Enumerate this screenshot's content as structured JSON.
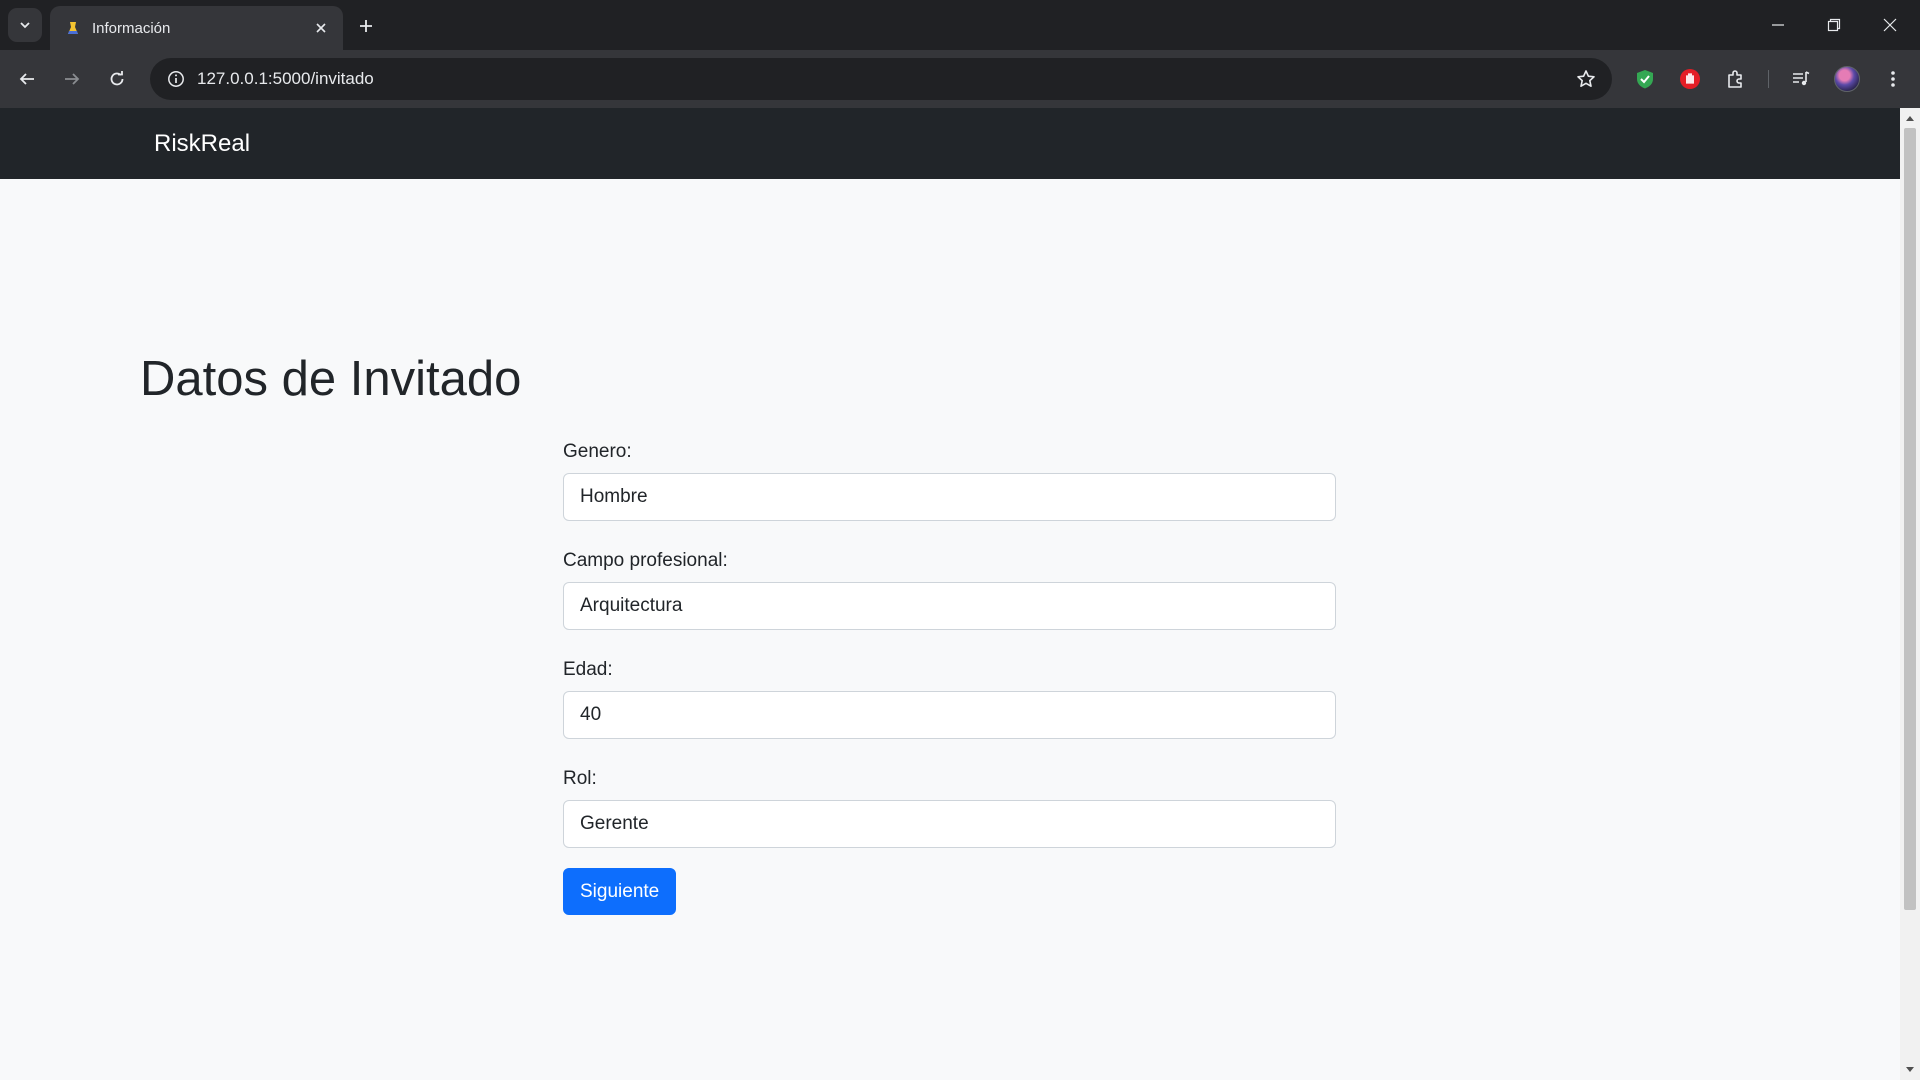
{
  "browser": {
    "tab_title": "Información",
    "url": "127.0.0.1:5000/invitado",
    "icons": {
      "tab_search": "chevron-down-icon",
      "favicon": "flask-favicon-icon",
      "close": "close-icon",
      "new_tab": "plus-icon",
      "back": "arrow-left-icon",
      "forward": "arrow-right-icon",
      "reload": "reload-icon",
      "site_info": "info-icon",
      "bookmark": "star-icon",
      "ext1": "shield-extension-icon",
      "ext2": "stop-hand-extension-icon",
      "extensions": "puzzle-icon",
      "media": "media-queue-icon",
      "menu": "kebab-menu-icon"
    },
    "colors": {
      "frame": "#202124",
      "toolbar": "#35363a",
      "text": "#e8eaed"
    }
  },
  "navbar": {
    "brand": "RiskReal"
  },
  "page": {
    "title": "Datos de Invitado",
    "form": {
      "fields": [
        {
          "label": "Genero:",
          "value": "Hombre"
        },
        {
          "label": "Campo profesional:",
          "value": "Arquitectura"
        },
        {
          "label": "Edad:",
          "value": "40"
        },
        {
          "label": "Rol:",
          "value": "Gerente"
        }
      ],
      "submit_label": "Siguiente"
    }
  },
  "colors": {
    "navbar": "#212529",
    "page_bg": "#f8f9fa",
    "primary": "#0d6efd"
  }
}
